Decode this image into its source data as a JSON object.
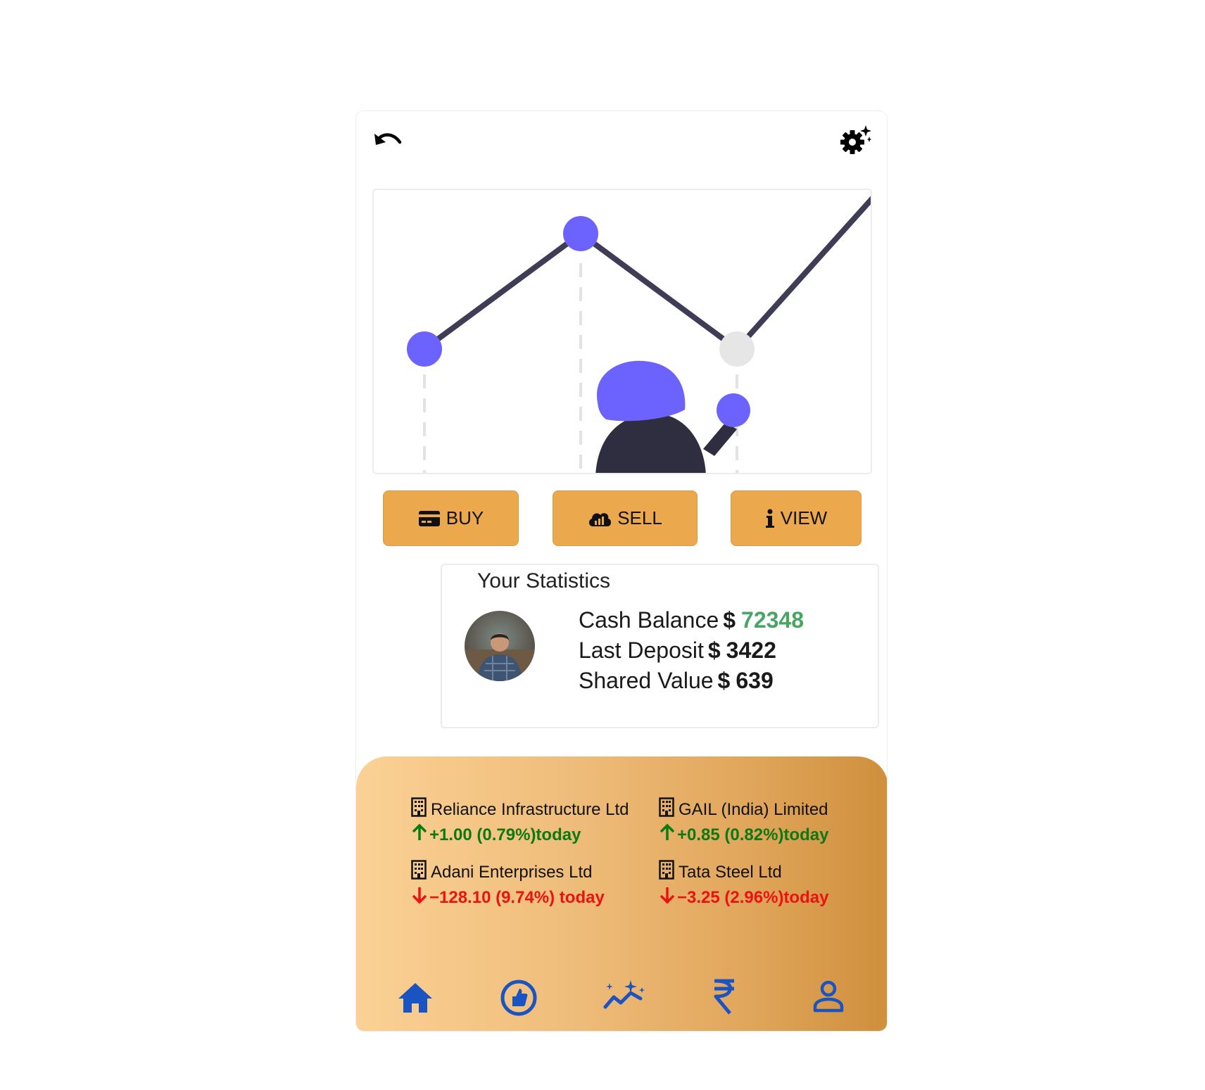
{
  "colors": {
    "button_bg": "#eca84c",
    "accent_purple": "#6c63ff",
    "positive": "#0c7a12",
    "negative": "#ee1111",
    "cash_value": "#4aa564",
    "nav_icon": "#1a53c2"
  },
  "header": {
    "left_icon": "undo-icon",
    "right_icon": "settings-sparkle-icon"
  },
  "actions": [
    {
      "label": "BUY",
      "icon": "credit-card-icon"
    },
    {
      "label": "SELL",
      "icon": "cloud-chart-icon"
    },
    {
      "label": "VIEW",
      "icon": "info-icon"
    }
  ],
  "stats": {
    "title": "Your Statistics",
    "rows": [
      {
        "label": "Cash Balance",
        "currency": "$",
        "value": "72348"
      },
      {
        "label": "Last Deposit",
        "currency": "$",
        "value": "3422"
      },
      {
        "label": "Shared Value",
        "currency": "$",
        "value": "639"
      }
    ]
  },
  "tickers": [
    {
      "name": "Reliance Infrastructure Ltd",
      "change": "+1.00 (0.79%)today",
      "direction": "up"
    },
    {
      "name": "GAIL (India) Limited",
      "change": "+0.85 (0.82%)today",
      "direction": "up"
    },
    {
      "name": "Adani Enterprises Ltd",
      "change": "−128.10 (9.74%) today",
      "direction": "down"
    },
    {
      "name": "Tata Steel Ltd",
      "change": "−3.25 (2.96%)today",
      "direction": "down"
    }
  ],
  "bottom_nav": [
    {
      "icon": "home-icon"
    },
    {
      "icon": "thumbs-up-icon"
    },
    {
      "icon": "trending-sparkle-icon"
    },
    {
      "icon": "rupee-icon"
    },
    {
      "icon": "profile-icon"
    }
  ]
}
